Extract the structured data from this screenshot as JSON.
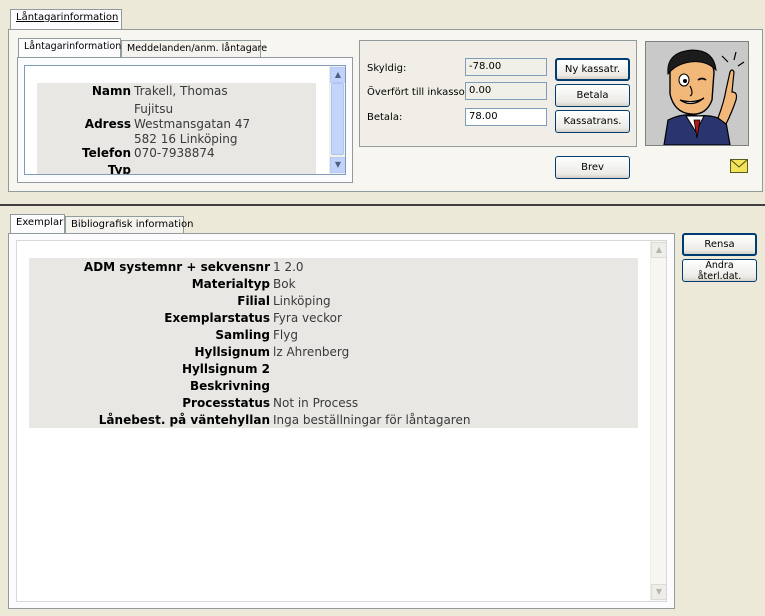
{
  "top_tab": "Låntagarinformation",
  "borrower_tabs": [
    "Låntagarinformation",
    "Meddelanden/anm. låntagare"
  ],
  "borrower": {
    "name_label": "Namn",
    "name_value": "Trakell, Thomas",
    "address_company": "Fujitsu",
    "address_label": "Adress",
    "address_street": "Westmansgatan 47",
    "address_city": "582 16 Linköping",
    "phone_label": "Telefon",
    "phone_value": "070-7938874",
    "type_label": "Typ"
  },
  "payment": {
    "owed_label": "Skyldig:",
    "owed_value": "-78.00",
    "collections_label": "Överfört till inkasso:",
    "collections_value": "0.00",
    "pay_label": "Betala:",
    "pay_value": "78.00"
  },
  "buttons": {
    "new_cash": "Ny kassatr.",
    "pay": "Betala",
    "cash_trans": "Kassatrans.",
    "letter": "Brev",
    "clear": "Rensa",
    "change_return": "Ändra återl.dat."
  },
  "copy_tabs": [
    "Exemplar",
    "Bibliografisk information"
  ],
  "copy_rows": [
    {
      "key": "ADM systemnr + sekvensnr",
      "value": "1 2.0"
    },
    {
      "key": "Materialtyp",
      "value": "Bok"
    },
    {
      "key": "Filial",
      "value": "Linköping"
    },
    {
      "key": "Exemplarstatus",
      "value": "Fyra veckor"
    },
    {
      "key": "Samling",
      "value": "Flyg"
    },
    {
      "key": "Hyllsignum",
      "value": "lz Ahrenberg"
    },
    {
      "key": "Hyllsignum 2",
      "value": ""
    },
    {
      "key": "Beskrivning",
      "value": ""
    },
    {
      "key": "Processtatus",
      "value": "Not in Process"
    },
    {
      "key": "Lånebest. på väntehyllan",
      "value": "Inga beställningar för låntagaren"
    }
  ],
  "icons": {
    "avatar": "cartoon-man-pointing",
    "mail": "envelope-icon",
    "scroll_up": "chevron-up-icon",
    "scroll_down": "chevron-down-icon"
  }
}
